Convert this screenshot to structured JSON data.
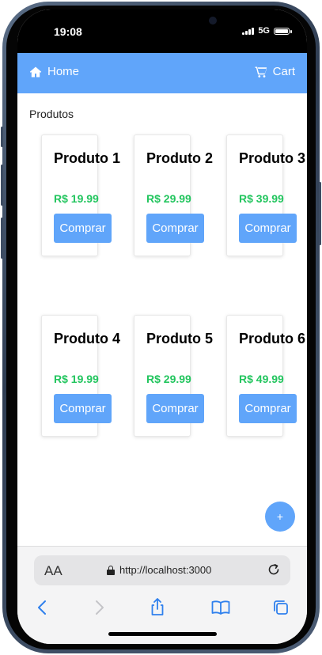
{
  "status": {
    "time": "19:08",
    "network": "5G"
  },
  "nav": {
    "home_label": "Home",
    "cart_label": "Cart"
  },
  "page": {
    "title": "Produtos"
  },
  "products": [
    {
      "name": "Produto 1",
      "price": "R$ 19.99",
      "button": "Comprar"
    },
    {
      "name": "Produto 2",
      "price": "R$ 29.99",
      "button": "Comprar"
    },
    {
      "name": "Produto 3",
      "price": "R$ 39.99",
      "button": "Comprar"
    },
    {
      "name": "Produto 4",
      "price": "R$ 19.99",
      "button": "Comprar"
    },
    {
      "name": "Produto 5",
      "price": "R$ 29.99",
      "button": "Comprar"
    },
    {
      "name": "Produto 6",
      "price": "R$ 49.99",
      "button": "Comprar"
    }
  ],
  "fab": {
    "label": "+"
  },
  "browser": {
    "text_size_label": "AA",
    "url": "http://localhost:3000"
  },
  "colors": {
    "accent": "#60a5fa",
    "price": "#22c55e"
  },
  "icons": [
    "home-icon",
    "cart-icon",
    "lock-icon",
    "reload-icon",
    "back-icon",
    "forward-icon",
    "share-icon",
    "bookmarks-icon",
    "tabs-icon"
  ]
}
